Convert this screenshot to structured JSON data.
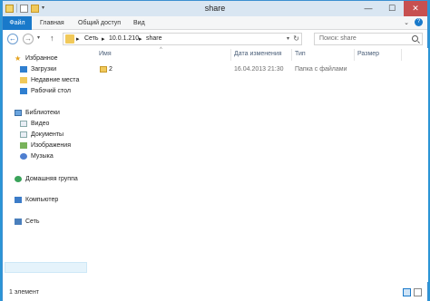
{
  "window": {
    "title": "share",
    "buttons": {
      "minimize": "—",
      "maximize": "☐",
      "close": "✕"
    }
  },
  "ribbon": {
    "tabs": [
      {
        "label": "Файл"
      },
      {
        "label": "Главная"
      },
      {
        "label": "Общий доступ"
      },
      {
        "label": "Вид"
      }
    ],
    "help": "?"
  },
  "address": {
    "crumbs": [
      "Сеть",
      "10.0.1.210",
      "share"
    ],
    "separator": "▸"
  },
  "search": {
    "placeholder": "Поиск: share"
  },
  "navigation": {
    "items": [
      {
        "label": "Избранное",
        "icon": "star-icon"
      },
      {
        "label": "Загрузки",
        "icon": "downloads-icon"
      },
      {
        "label": "Недавние места",
        "icon": "recent-places-icon"
      },
      {
        "label": "Рабочий стол",
        "icon": "desktop-icon"
      },
      {
        "label": "Библиотеки",
        "icon": "libraries-icon"
      },
      {
        "label": "Видео",
        "icon": "video-icon"
      },
      {
        "label": "Документы",
        "icon": "documents-icon"
      },
      {
        "label": "Изображения",
        "icon": "images-icon"
      },
      {
        "label": "Музыка",
        "icon": "music-icon"
      },
      {
        "label": "Домашняя группа",
        "icon": "homegroup-icon"
      },
      {
        "label": "Компьютер",
        "icon": "computer-icon"
      },
      {
        "label": "Сеть",
        "icon": "network-icon"
      }
    ],
    "selected": "Сеть"
  },
  "files": {
    "columns": [
      "Имя",
      "Дата изменения",
      "Тип",
      "Размер"
    ],
    "rows": [
      {
        "name": "2",
        "modified": "16.04.2013 21:30",
        "type": "Папка с файлами",
        "size": ""
      }
    ]
  },
  "status": {
    "text": "1 элемент"
  }
}
